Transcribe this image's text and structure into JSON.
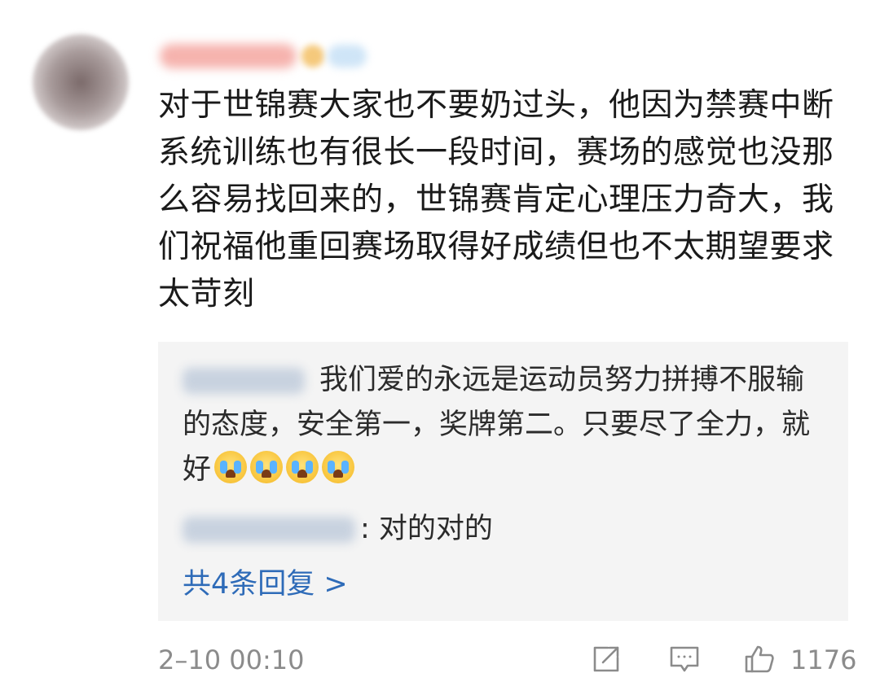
{
  "comment": {
    "text": "对于世锦赛大家也不要奶过头，他因为禁赛中断系统训练也有很长一段时间，赛场的感觉也没那么容易找回来的，世锦赛肯定心理压力奇大，我们祝福他重回赛场取得好成绩但也不太期望要求太苛刻"
  },
  "replies": [
    {
      "text": "我们爱的永远是运动员努力拼搏不服输的态度，安全第一，奖牌第二。只要尽了全力，就好",
      "emoji_name": "crying-face-emoji",
      "emoji_count": 4
    },
    {
      "text": ": 对的对的"
    }
  ],
  "more_replies_label": "共4条回复 >",
  "footer": {
    "timestamp": "2–10 00:10",
    "like_count": "1176"
  },
  "colors": {
    "link": "#2e6bb8",
    "muted": "#8b8b8b",
    "reply_bg": "#f4f4f4"
  }
}
